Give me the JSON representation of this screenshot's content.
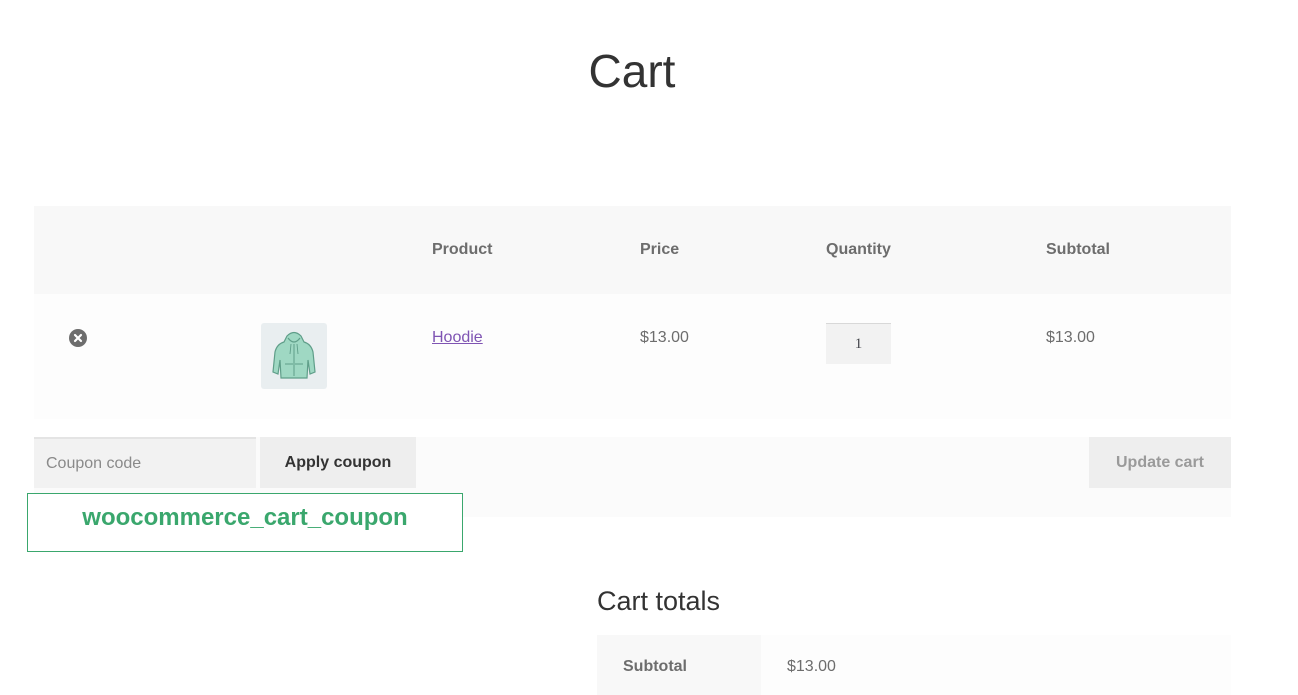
{
  "page": {
    "title": "Cart"
  },
  "cart_table": {
    "headers": {
      "product": "Product",
      "price": "Price",
      "quantity": "Quantity",
      "subtotal": "Subtotal"
    },
    "items": [
      {
        "name": "Hoodie",
        "price": "$13.00",
        "quantity": "1",
        "subtotal": "$13.00",
        "thumbnail_icon": "hoodie-icon"
      }
    ]
  },
  "actions": {
    "coupon_placeholder": "Coupon code",
    "apply_label": "Apply coupon",
    "update_label": "Update cart"
  },
  "hook_label": "woocommerce_cart_coupon",
  "totals": {
    "title": "Cart totals",
    "subtotal_label": "Subtotal",
    "subtotal_value": "$13.00"
  },
  "colors": {
    "link": "#7f54b3",
    "hook_green": "#3aa76d",
    "header_bg": "#f8f8f8"
  }
}
